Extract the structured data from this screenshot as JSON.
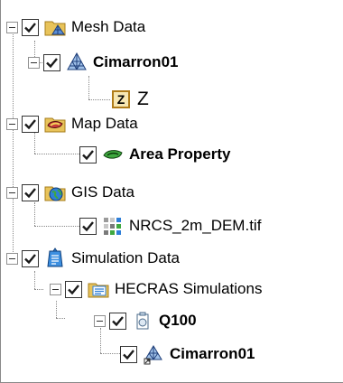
{
  "tree": {
    "items": [
      {
        "label": "Mesh Data",
        "bold": false,
        "icon": "mesh-folder-icon"
      },
      {
        "label": "Cimarron01",
        "bold": true,
        "icon": "mesh-icon"
      },
      {
        "label": "Z",
        "bold": false,
        "icon": "dataset-z-icon"
      },
      {
        "label": "Map Data",
        "bold": false,
        "icon": "map-folder-icon"
      },
      {
        "label": "Area Property",
        "bold": true,
        "icon": "area-property-icon"
      },
      {
        "label": "GIS Data",
        "bold": false,
        "icon": "gis-globe-icon"
      },
      {
        "label": "NRCS_2m_DEM.tif",
        "bold": false,
        "icon": "raster-icon"
      },
      {
        "label": "Simulation Data",
        "bold": false,
        "icon": "simulation-folder-icon"
      },
      {
        "label": "HECRAS Simulations",
        "bold": false,
        "icon": "hecras-folder-icon"
      },
      {
        "label": "Q100",
        "bold": true,
        "icon": "simulation-icon"
      },
      {
        "label": "Cimarron01",
        "bold": true,
        "icon": "mesh-link-icon"
      }
    ]
  },
  "colors": {
    "check": "#1a1a1a",
    "tree_line": "#888888",
    "folder": "#e8c35a",
    "globe": "#2f7fd8"
  }
}
